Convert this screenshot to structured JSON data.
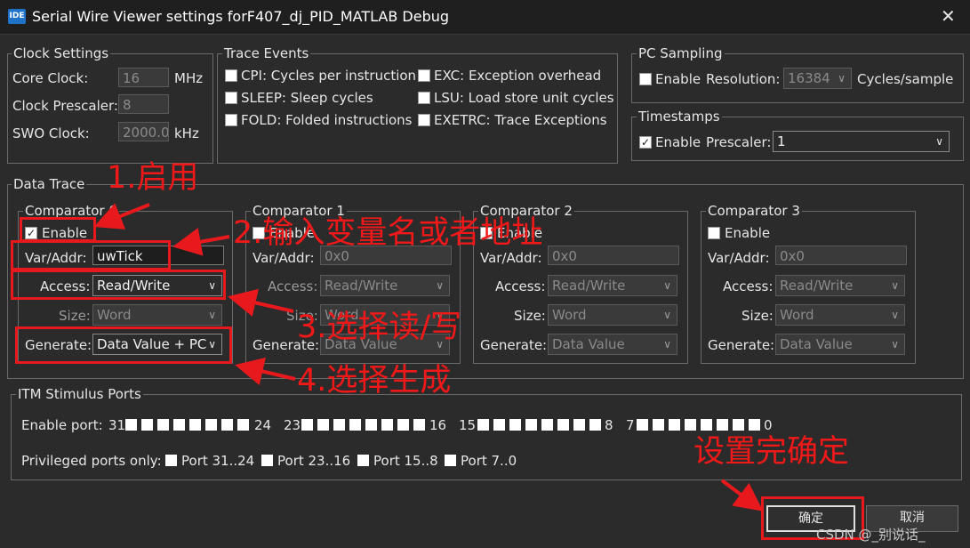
{
  "window": {
    "app_icon": "IDE",
    "title": "Serial Wire Viewer settings forF407_dj_PID_MATLAB Debug",
    "close_icon": "close-icon"
  },
  "clock": {
    "title": "Clock Settings",
    "core_label": "Core Clock:",
    "core_value": "16",
    "core_unit": "MHz",
    "presc_label": "Clock Prescaler:",
    "presc_value": "8",
    "swo_label": "SWO Clock:",
    "swo_value": "2000.0",
    "swo_unit": "kHz"
  },
  "trace": {
    "title": "Trace Events",
    "cpi": "CPI: Cycles per instruction",
    "sleep": "SLEEP: Sleep cycles",
    "fold": "FOLD: Folded instructions",
    "exc": "EXC: Exception overhead",
    "lsu": "LSU: Load store unit cycles",
    "exetrc": "EXETRC: Trace Exceptions"
  },
  "pc": {
    "title": "PC Sampling",
    "enable": "Enable",
    "res_label": "Resolution:",
    "res_value": "16384",
    "res_unit": "Cycles/sample"
  },
  "timestamps": {
    "title": "Timestamps",
    "enable": "Enable",
    "checked": true,
    "presc_label": "Prescaler:",
    "presc_value": "1"
  },
  "data_trace": {
    "title": "Data Trace",
    "labels": {
      "enable": "Enable",
      "var": "Var/Addr:",
      "access": "Access:",
      "size": "Size:",
      "generate": "Generate:"
    },
    "comparators": [
      {
        "name": "Comparator 0",
        "checked": true,
        "var": "uwTick",
        "access": "Read/Write",
        "size": "Word",
        "generate": "Data Value + PC"
      },
      {
        "name": "Comparator 1",
        "checked": false,
        "var": "0x0",
        "access": "Read/Write",
        "size": "Word",
        "generate": "Data Value"
      },
      {
        "name": "Comparator 2",
        "checked": false,
        "var": "0x0",
        "access": "Read/Write",
        "size": "Word",
        "generate": "Data Value"
      },
      {
        "name": "Comparator 3",
        "checked": false,
        "var": "0x0",
        "access": "Read/Write",
        "size": "Word",
        "generate": "Data Value"
      }
    ]
  },
  "itm": {
    "title": "ITM Stimulus Ports",
    "enable_label": "Enable port:",
    "groups": [
      {
        "hi": "31",
        "lo": "24"
      },
      {
        "hi": "23",
        "lo": "16"
      },
      {
        "hi": "15",
        "lo": "8"
      },
      {
        "hi": "7",
        "lo": "0"
      }
    ],
    "priv_label": "Privileged ports only:",
    "priv_ports": [
      "Port 31..24",
      "Port 23..16",
      "Port 15..8",
      "Port 7..0"
    ]
  },
  "buttons": {
    "ok": "确定",
    "cancel": "取消"
  },
  "annotations": {
    "a1": "1.启用",
    "a2": "2.输入变量名或者地址",
    "a3": "3.选择读/写",
    "a4": "4.选择生成",
    "a5": "设置完确定"
  },
  "watermark": "CSDN @_别说话_",
  "colors": {
    "annotation_red": "#e8191c",
    "dialog_bg": "#2b2b2b"
  }
}
